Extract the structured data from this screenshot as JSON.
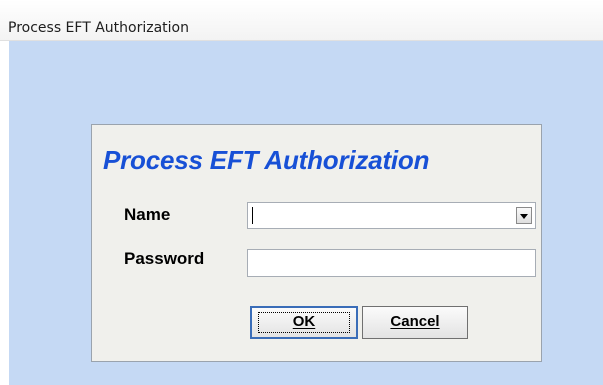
{
  "window": {
    "title": "Process EFT Authorization"
  },
  "dialog": {
    "heading": "Process EFT Authorization",
    "name_label": "Name",
    "name_value": "",
    "password_label": "Password",
    "password_value": "",
    "ok_label": "OK",
    "cancel_label": "Cancel"
  },
  "colors": {
    "client_background": "#c5d9f4",
    "panel_background": "#f0f0ec",
    "heading_color": "#1750d6"
  },
  "icons": {
    "dropdown": "chevron-down-icon"
  }
}
